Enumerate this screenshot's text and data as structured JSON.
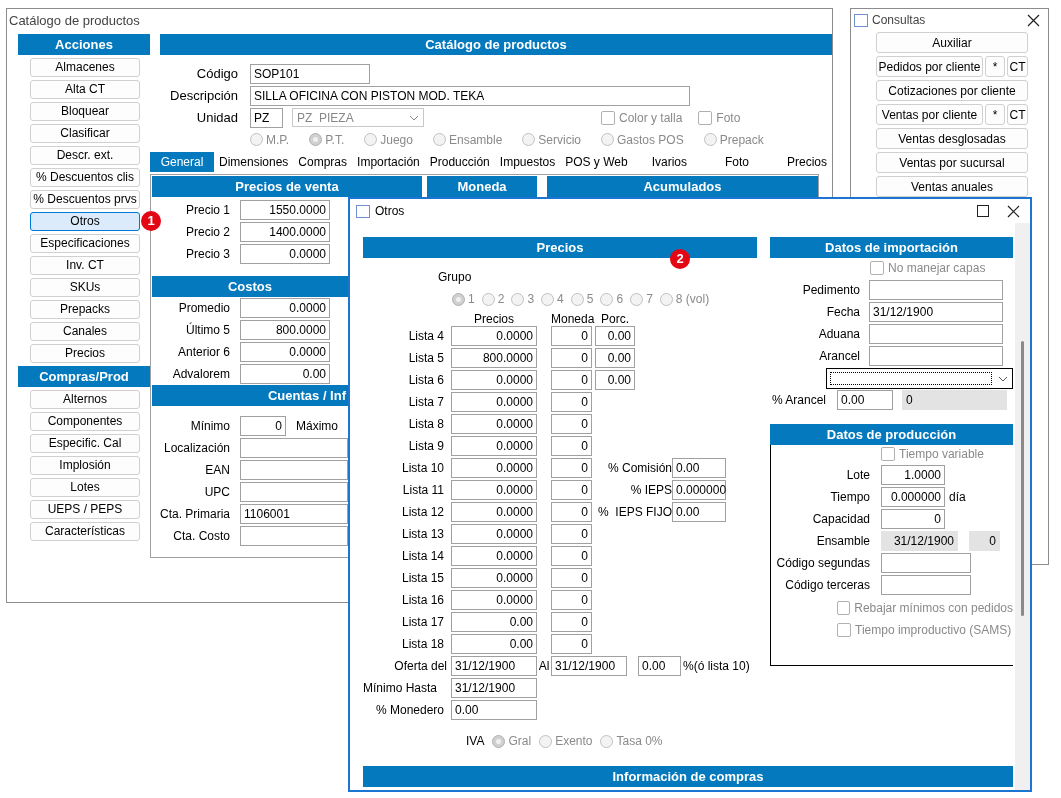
{
  "main_window": {
    "title": "Catálogo de productos",
    "sidebar": [
      {
        "header": "Acciones",
        "items": [
          {
            "label": "Almacenes",
            "selected": false
          },
          {
            "label": "Alta CT",
            "selected": false
          },
          {
            "label": "Bloquear",
            "selected": false
          },
          {
            "label": "Clasificar",
            "selected": false
          },
          {
            "label": "Descr. ext.",
            "selected": false
          },
          {
            "label": "% Descuentos clis",
            "selected": false
          },
          {
            "label": "% Descuentos prvs",
            "selected": false
          },
          {
            "label": "Otros",
            "selected": true,
            "badge": "1"
          },
          {
            "label": "Especificaciones",
            "selected": false
          },
          {
            "label": "Inv. CT",
            "selected": false
          },
          {
            "label": "SKUs",
            "selected": false
          },
          {
            "label": "Prepacks",
            "selected": false
          },
          {
            "label": "Canales",
            "selected": false
          },
          {
            "label": "Precios",
            "selected": false
          }
        ]
      },
      {
        "header": "Compras/Prod",
        "items": [
          {
            "label": "Alternos",
            "selected": false
          },
          {
            "label": "Componentes",
            "selected": false
          },
          {
            "label": "Especific. Cal",
            "selected": false
          },
          {
            "label": "Implosión",
            "selected": false
          },
          {
            "label": "Lotes",
            "selected": false
          },
          {
            "label": "UEPS / PEPS",
            "selected": false
          },
          {
            "label": "Características",
            "selected": false
          }
        ]
      }
    ],
    "header": "Catálogo de productos",
    "form": {
      "code_label": "Código",
      "code": "SOP101",
      "description_label": "Descripción",
      "description": "SILLA OFICINA CON PISTON MOD. TEKA",
      "unit_label": "Unidad",
      "unit": "PZ",
      "unit_select": "PZ  PIEZA",
      "checkboxes": [
        {
          "label": "Color y talla",
          "checked": false
        },
        {
          "label": "Foto",
          "checked": false
        }
      ],
      "types": [
        {
          "label": "M.P.",
          "selected": false
        },
        {
          "label": "P.T.",
          "selected": true
        },
        {
          "label": "Juego",
          "selected": false
        },
        {
          "label": "Ensamble",
          "selected": false
        },
        {
          "label": "Servicio",
          "selected": false
        },
        {
          "label": "Gastos POS",
          "selected": false
        },
        {
          "label": "Prepack",
          "selected": false
        }
      ]
    },
    "tabs": [
      {
        "label": "General",
        "selected": true
      },
      {
        "label": "Dimensiones",
        "selected": false
      },
      {
        "label": "Compras",
        "selected": false
      },
      {
        "label": "Importación",
        "selected": false
      },
      {
        "label": "Producción",
        "selected": false
      },
      {
        "label": "Impuestos",
        "selected": false
      },
      {
        "label": "POS y Web",
        "selected": false
      },
      {
        "label": "Ivarios",
        "selected": false
      },
      {
        "label": "Foto",
        "selected": false
      },
      {
        "label": "Precios",
        "selected": false
      }
    ],
    "section_headers": [
      "Precios de venta",
      "Moneda",
      "Acumulados"
    ],
    "prices": [
      {
        "label": "Precio 1",
        "value": "1550.0000"
      },
      {
        "label": "Precio 2",
        "value": "1400.0000"
      },
      {
        "label": "Precio 3",
        "value": "0.0000"
      }
    ],
    "costs_header": "Costos",
    "costs": [
      {
        "label": "Promedio",
        "value": "0.0000"
      },
      {
        "label": "Último 5",
        "value": "800.0000"
      },
      {
        "label": "Anterior 6",
        "value": "0.0000"
      },
      {
        "label": "Advalorem",
        "value": "0.00"
      }
    ],
    "accounts_header": "Cuentas / Inf",
    "minimum": {
      "label": "Mínimo",
      "value": "0",
      "max_label": "Máximo"
    },
    "accounts": [
      {
        "label": "Localización"
      },
      {
        "label": "EAN"
      },
      {
        "label": "UPC"
      },
      {
        "label": "Cta. Primaria",
        "value": "1106001"
      },
      {
        "label": "Cta. Costo"
      }
    ]
  },
  "consultas": {
    "title": "Consultas",
    "buttons": [
      {
        "label": "Auxiliar"
      },
      {
        "label": "Pedidos por cliente",
        "extras": [
          "*",
          "CT"
        ]
      },
      {
        "label": "Cotizaciones por cliente"
      },
      {
        "label": "Ventas por cliente",
        "extras": [
          "*",
          "CT"
        ]
      },
      {
        "label": "Ventas desglosadas"
      },
      {
        "label": "Ventas por sucursal"
      },
      {
        "label": "Ventas anuales"
      }
    ]
  },
  "dialog": {
    "title": "Otros",
    "prices_header": "Precios",
    "badge": "2",
    "group_label": "Grupo",
    "groups": [
      {
        "label": "1",
        "selected": true
      },
      {
        "label": "2",
        "selected": false
      },
      {
        "label": "3",
        "selected": false
      },
      {
        "label": "4",
        "selected": false
      },
      {
        "label": "5",
        "selected": false
      },
      {
        "label": "6",
        "selected": false
      },
      {
        "label": "7",
        "selected": false
      },
      {
        "label": "8 (vol)",
        "selected": false
      }
    ],
    "columns": [
      "Precios",
      "Moneda",
      "Porc."
    ],
    "lists": [
      {
        "label": "Lista 4",
        "price": "0.0000",
        "currency": "0",
        "percent": "0.00"
      },
      {
        "label": "Lista 5",
        "price": "800.0000",
        "currency": "0",
        "percent": "0.00"
      },
      {
        "label": "Lista 6",
        "price": "0.0000",
        "currency": "0",
        "percent": "0.00"
      },
      {
        "label": "Lista 7",
        "price": "0.0000",
        "currency": "0"
      },
      {
        "label": "Lista 8",
        "price": "0.0000",
        "currency": "0"
      },
      {
        "label": "Lista 9",
        "price": "0.0000",
        "currency": "0"
      },
      {
        "label": "Lista 10",
        "price": "0.0000",
        "currency": "0",
        "side": {
          "label": "% Comisión",
          "value": "0.00"
        }
      },
      {
        "label": "Lista 11",
        "price": "0.0000",
        "currency": "0",
        "side": {
          "label": "% IEPS",
          "value": "0.000000"
        }
      },
      {
        "label": "Lista 12",
        "price": "0.0000",
        "currency": "0",
        "side": {
          "label": "%  IEPS FIJO",
          "value": "0.00"
        }
      },
      {
        "label": "Lista 13",
        "price": "0.0000",
        "currency": "0"
      },
      {
        "label": "Lista 14",
        "price": "0.0000",
        "currency": "0"
      },
      {
        "label": "Lista 15",
        "price": "0.0000",
        "currency": "0"
      },
      {
        "label": "Lista 16",
        "price": "0.0000",
        "currency": "0"
      },
      {
        "label": "Lista 17",
        "price": "0.00",
        "currency": "0"
      },
      {
        "label": "Lista 18",
        "price": "0.00",
        "currency": "0"
      }
    ],
    "offer": {
      "label": "Oferta del",
      "from": "31/12/1900",
      "to_label": "Al",
      "to": "31/12/1900",
      "percent": "0.00",
      "note": "%(ó lista 10)"
    },
    "min_until": {
      "label": "Mínimo Hasta",
      "value": "31/12/1900"
    },
    "wallet": {
      "label": "% Monedero",
      "value": "0.00"
    },
    "iva": {
      "label": "IVA",
      "options": [
        {
          "label": "Gral",
          "selected": true
        },
        {
          "label": "Exento",
          "selected": false
        },
        {
          "label": "Tasa 0%",
          "selected": false
        }
      ]
    },
    "import": {
      "header": "Datos de importación",
      "no_layers": {
        "label": "No manejar capas",
        "checked": false
      },
      "fields": [
        {
          "label": "Pedimento"
        },
        {
          "label": "Fecha",
          "value": "31/12/1900"
        },
        {
          "label": "Aduana"
        },
        {
          "label": "Arancel"
        }
      ],
      "tariff": {
        "label": "% Arancel",
        "value": "0.00",
        "readout": "0"
      }
    },
    "production": {
      "header": "Datos de producción",
      "variable_time": {
        "label": "Tiempo variable",
        "checked": false
      },
      "fields": [
        {
          "kind": "number",
          "label": "Lote",
          "value": "1.0000"
        },
        {
          "kind": "number",
          "label": "Tiempo",
          "value": "0.000000",
          "unit": "día"
        },
        {
          "kind": "number",
          "label": "Capacidad",
          "value": "0"
        },
        {
          "kind": "readonly",
          "label": "Ensamble",
          "value": "31/12/1900",
          "extra": "0"
        },
        {
          "kind": "text",
          "label": "Código segundas"
        },
        {
          "kind": "text",
          "label": "Código terceras"
        }
      ],
      "options": [
        {
          "label": "Rebajar mínimos con pedidos",
          "checked": false
        },
        {
          "label": "Tiempo improductivo (SAMS)",
          "checked": false
        }
      ]
    },
    "purchases_header": "Información de compras"
  }
}
